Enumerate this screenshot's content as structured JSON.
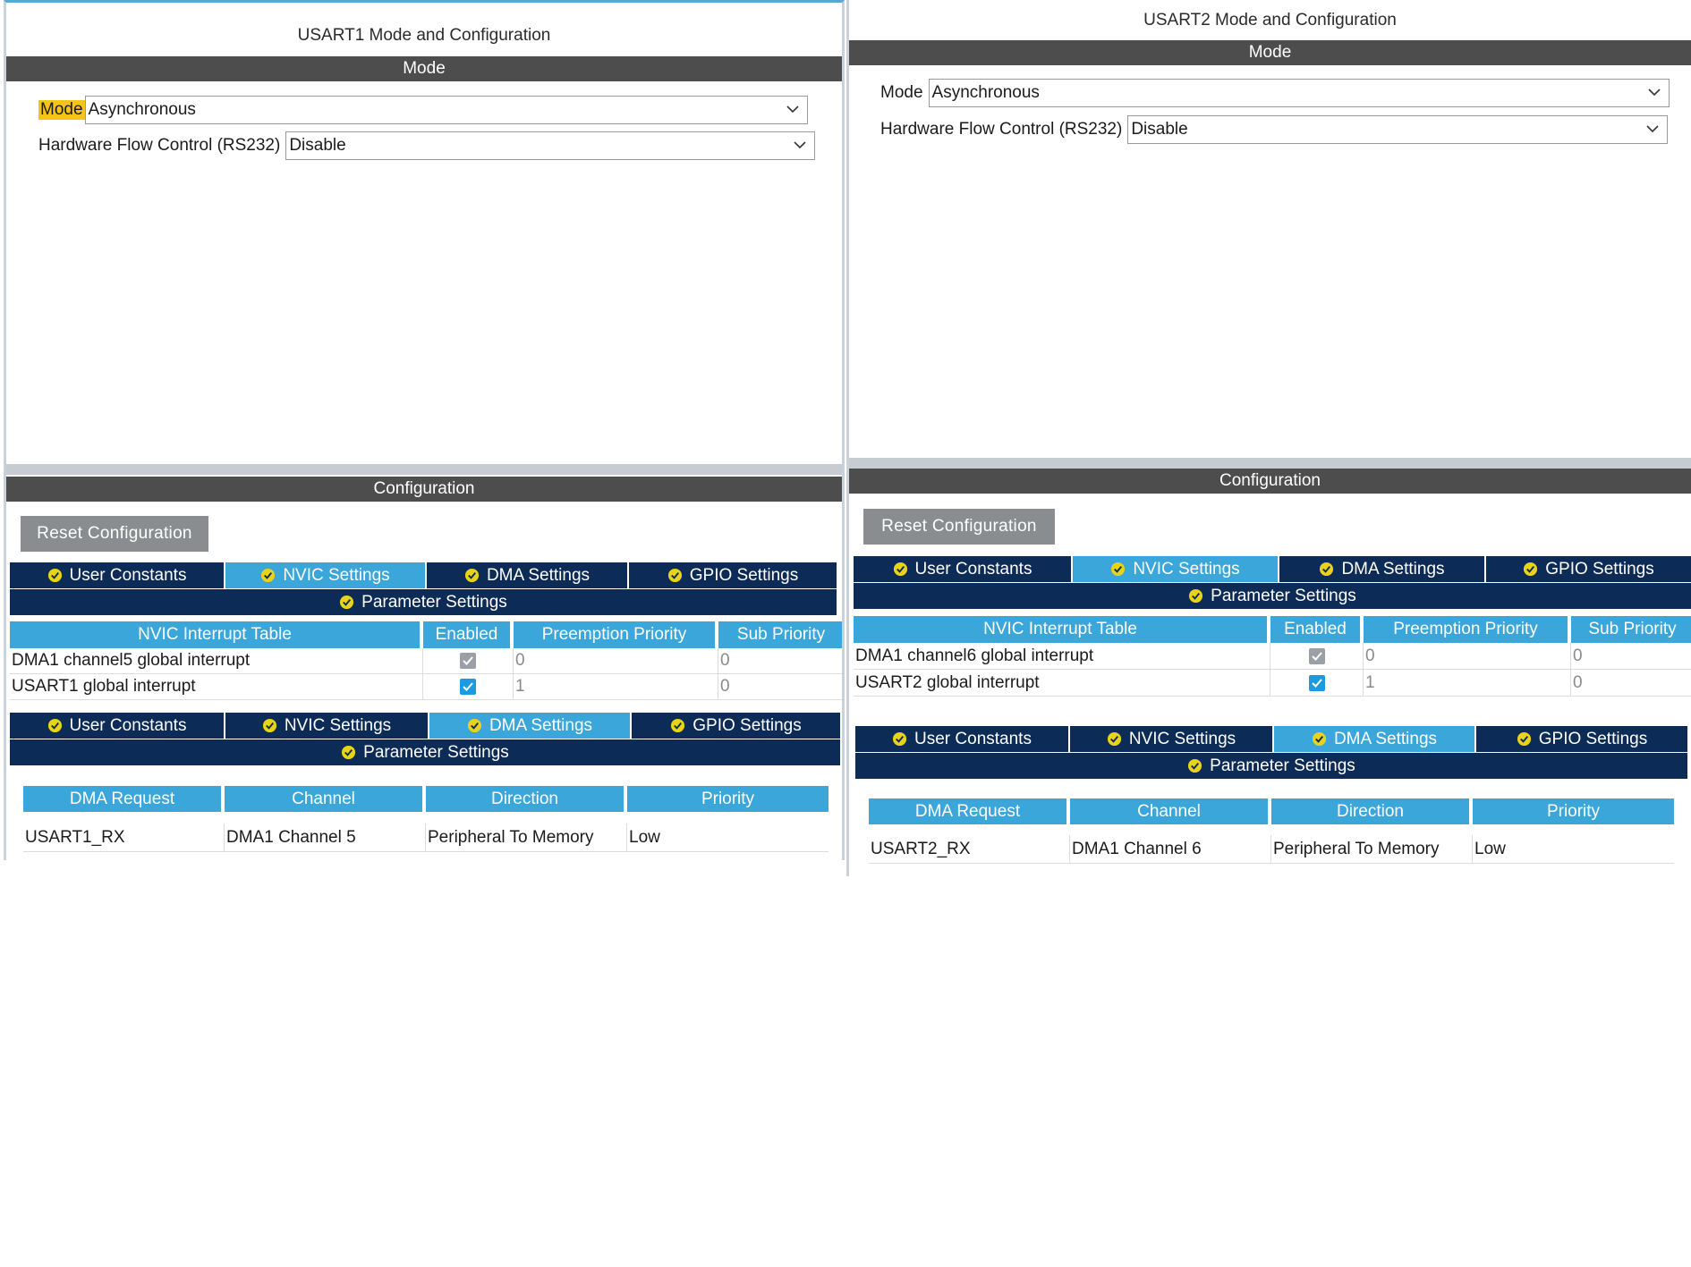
{
  "usart1": {
    "title": "USART1 Mode and Configuration",
    "mode_bar": "Mode",
    "mode_label": "Mode",
    "mode_value": "Asynchronous",
    "hw_flow_label": "Hardware Flow Control (RS232)",
    "hw_flow_value": "Disable",
    "config_bar": "Configuration",
    "reset_label": "Reset Configuration",
    "tabs_a": [
      {
        "label": "User Constants"
      },
      {
        "label": "NVIC Settings"
      },
      {
        "label": "DMA Settings"
      },
      {
        "label": "GPIO Settings"
      }
    ],
    "param_label_a": "Parameter Settings",
    "nvic_headers": [
      "NVIC Interrupt Table",
      "Enabled",
      "Preemption Priority",
      "Sub Priority"
    ],
    "nvic_rows": [
      {
        "name": "DMA1 channel5 global interrupt",
        "enabled": true,
        "preemption": "0",
        "sub": "0"
      },
      {
        "name": "USART1 global interrupt",
        "enabled": true,
        "preemption": "1",
        "sub": "0"
      }
    ],
    "tabs_b": [
      {
        "label": "User Constants"
      },
      {
        "label": "NVIC Settings"
      },
      {
        "label": "DMA Settings"
      },
      {
        "label": "GPIO Settings"
      }
    ],
    "param_label_b": "Parameter Settings",
    "dma_headers": [
      "DMA Request",
      "Channel",
      "Direction",
      "Priority"
    ],
    "dma_rows": [
      {
        "request": "USART1_RX",
        "channel": "DMA1 Channel 5",
        "direction": "Peripheral To Memory",
        "priority": "Low"
      }
    ]
  },
  "usart2": {
    "title": "USART2 Mode and Configuration",
    "mode_bar": "Mode",
    "mode_label": "Mode",
    "mode_value": "Asynchronous",
    "hw_flow_label": "Hardware Flow Control (RS232)",
    "hw_flow_value": "Disable",
    "config_bar": "Configuration",
    "reset_label": "Reset Configuration",
    "tabs_a": [
      {
        "label": "User Constants"
      },
      {
        "label": "NVIC Settings"
      },
      {
        "label": "DMA Settings"
      },
      {
        "label": "GPIO Settings"
      }
    ],
    "param_label_a": "Parameter Settings",
    "nvic_headers": [
      "NVIC Interrupt Table",
      "Enabled",
      "Preemption Priority",
      "Sub Priority"
    ],
    "nvic_rows": [
      {
        "name": "DMA1 channel6 global interrupt",
        "enabled": true,
        "preemption": "0",
        "sub": "0"
      },
      {
        "name": "USART2 global interrupt",
        "enabled": true,
        "preemption": "1",
        "sub": "0"
      }
    ],
    "tabs_b": [
      {
        "label": "User Constants"
      },
      {
        "label": "NVIC Settings"
      },
      {
        "label": "DMA Settings"
      },
      {
        "label": "GPIO Settings"
      }
    ],
    "param_label_b": "Parameter Settings",
    "dma_headers": [
      "DMA Request",
      "Channel",
      "Direction",
      "Priority"
    ],
    "dma_rows": [
      {
        "request": "USART2_RX",
        "channel": "DMA1 Channel 6",
        "direction": "Peripheral To Memory",
        "priority": "Low"
      }
    ]
  },
  "colors": {
    "accent": "#3ba6d9",
    "tab_dark": "#0d2b57",
    "bar_dark": "#4d4d4d",
    "highlight": "#f3c41a",
    "ok_icon": "#e8d21a"
  }
}
